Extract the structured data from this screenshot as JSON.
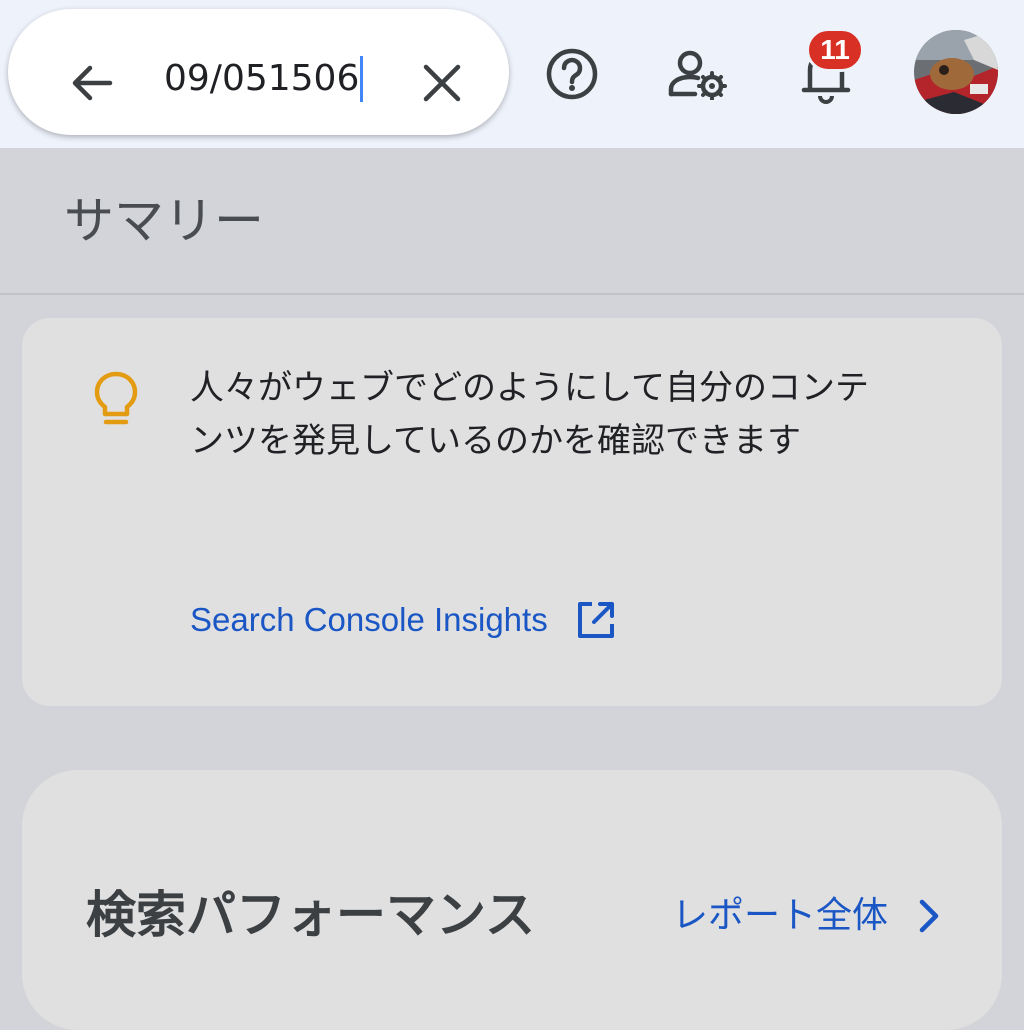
{
  "search": {
    "query": "09/051506"
  },
  "header": {
    "notification_count": "11"
  },
  "summary": {
    "title": "サマリー"
  },
  "insight": {
    "text": "人々がウェブでどのようにして自分のコンテンツを発見しているのかを確認できます",
    "link_label": "Search Console Insights"
  },
  "performance": {
    "title": "検索パフォーマンス",
    "full_report_label": "レポート全体"
  },
  "icons": {
    "back": "arrow-back-icon",
    "clear": "close-icon",
    "help": "help-circle-icon",
    "admin": "manage-accounts-icon",
    "notifications": "bell-icon",
    "insight": "lightbulb-icon",
    "open_external": "open-in-new-icon",
    "chevron": "chevron-right-icon"
  },
  "colors": {
    "accent_link": "#1a56c4",
    "badge": "#d93025",
    "bulb": "#e39b12",
    "caret": "#4285f4"
  }
}
